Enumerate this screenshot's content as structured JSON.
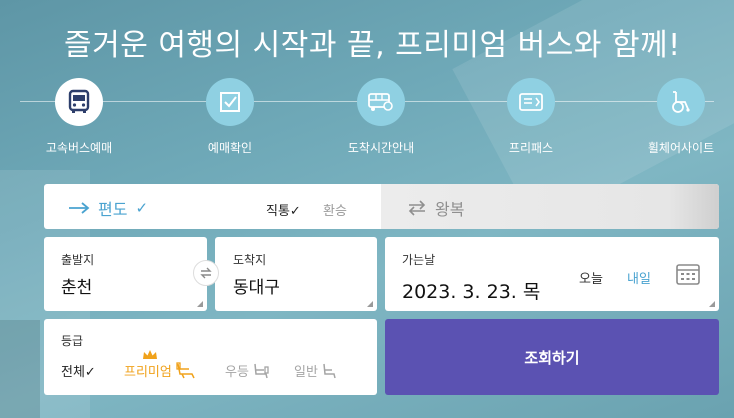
{
  "headline": "즐거운 여행의 시작과 끝, 프리미엄 버스와 함께!",
  "menu": [
    {
      "label": "고속버스예매",
      "icon": "bus-icon",
      "active": true
    },
    {
      "label": "예매확인",
      "icon": "checkbox-icon",
      "active": false
    },
    {
      "label": "도착시간안내",
      "icon": "bus-schedule-icon",
      "active": false
    },
    {
      "label": "프리패스",
      "icon": "ticket-icon",
      "active": false
    },
    {
      "label": "휠체어사이트",
      "icon": "wheelchair-icon",
      "active": false
    }
  ],
  "trip": {
    "oneway": "편도",
    "oneway_check": "✓",
    "direct": "직통✓",
    "transfer": "환승",
    "roundtrip": "왕복"
  },
  "departure": {
    "label": "출발지",
    "value": "춘천"
  },
  "arrival": {
    "label": "도착지",
    "value": "동대구"
  },
  "date": {
    "label": "가는날",
    "value": "2023. 3. 23. 목",
    "today": "오늘",
    "tomorrow": "내일"
  },
  "grade": {
    "label": "등급",
    "all": "전체✓",
    "premium": "프리미엄",
    "superior": "우등",
    "regular": "일반"
  },
  "search_button": "조회하기",
  "colors": {
    "accent_blue": "#4aa3d0",
    "premium_orange": "#f0a21b",
    "button_purple": "#5b52b2"
  }
}
